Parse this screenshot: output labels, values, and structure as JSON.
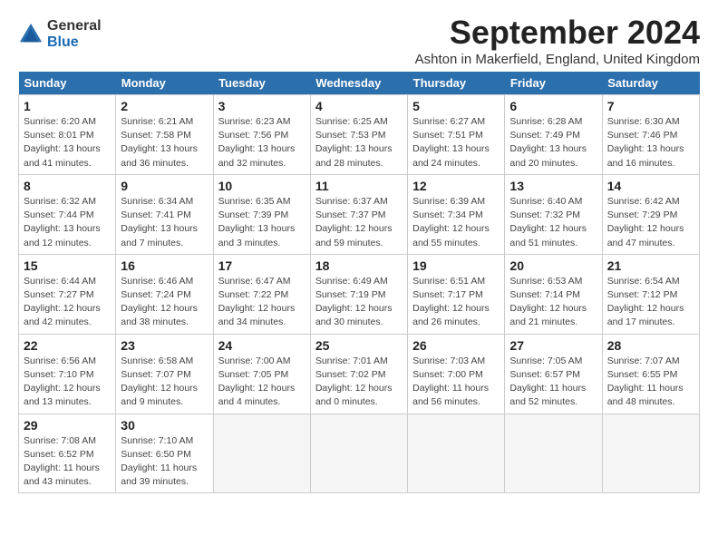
{
  "header": {
    "logo_general": "General",
    "logo_blue": "Blue",
    "month_title": "September 2024",
    "location": "Ashton in Makerfield, England, United Kingdom"
  },
  "weekdays": [
    "Sunday",
    "Monday",
    "Tuesday",
    "Wednesday",
    "Thursday",
    "Friday",
    "Saturday"
  ],
  "weeks": [
    [
      {
        "day": "1",
        "info": "Sunrise: 6:20 AM\nSunset: 8:01 PM\nDaylight: 13 hours\nand 41 minutes."
      },
      {
        "day": "2",
        "info": "Sunrise: 6:21 AM\nSunset: 7:58 PM\nDaylight: 13 hours\nand 36 minutes."
      },
      {
        "day": "3",
        "info": "Sunrise: 6:23 AM\nSunset: 7:56 PM\nDaylight: 13 hours\nand 32 minutes."
      },
      {
        "day": "4",
        "info": "Sunrise: 6:25 AM\nSunset: 7:53 PM\nDaylight: 13 hours\nand 28 minutes."
      },
      {
        "day": "5",
        "info": "Sunrise: 6:27 AM\nSunset: 7:51 PM\nDaylight: 13 hours\nand 24 minutes."
      },
      {
        "day": "6",
        "info": "Sunrise: 6:28 AM\nSunset: 7:49 PM\nDaylight: 13 hours\nand 20 minutes."
      },
      {
        "day": "7",
        "info": "Sunrise: 6:30 AM\nSunset: 7:46 PM\nDaylight: 13 hours\nand 16 minutes."
      }
    ],
    [
      {
        "day": "8",
        "info": "Sunrise: 6:32 AM\nSunset: 7:44 PM\nDaylight: 13 hours\nand 12 minutes."
      },
      {
        "day": "9",
        "info": "Sunrise: 6:34 AM\nSunset: 7:41 PM\nDaylight: 13 hours\nand 7 minutes."
      },
      {
        "day": "10",
        "info": "Sunrise: 6:35 AM\nSunset: 7:39 PM\nDaylight: 13 hours\nand 3 minutes."
      },
      {
        "day": "11",
        "info": "Sunrise: 6:37 AM\nSunset: 7:37 PM\nDaylight: 12 hours\nand 59 minutes."
      },
      {
        "day": "12",
        "info": "Sunrise: 6:39 AM\nSunset: 7:34 PM\nDaylight: 12 hours\nand 55 minutes."
      },
      {
        "day": "13",
        "info": "Sunrise: 6:40 AM\nSunset: 7:32 PM\nDaylight: 12 hours\nand 51 minutes."
      },
      {
        "day": "14",
        "info": "Sunrise: 6:42 AM\nSunset: 7:29 PM\nDaylight: 12 hours\nand 47 minutes."
      }
    ],
    [
      {
        "day": "15",
        "info": "Sunrise: 6:44 AM\nSunset: 7:27 PM\nDaylight: 12 hours\nand 42 minutes."
      },
      {
        "day": "16",
        "info": "Sunrise: 6:46 AM\nSunset: 7:24 PM\nDaylight: 12 hours\nand 38 minutes."
      },
      {
        "day": "17",
        "info": "Sunrise: 6:47 AM\nSunset: 7:22 PM\nDaylight: 12 hours\nand 34 minutes."
      },
      {
        "day": "18",
        "info": "Sunrise: 6:49 AM\nSunset: 7:19 PM\nDaylight: 12 hours\nand 30 minutes."
      },
      {
        "day": "19",
        "info": "Sunrise: 6:51 AM\nSunset: 7:17 PM\nDaylight: 12 hours\nand 26 minutes."
      },
      {
        "day": "20",
        "info": "Sunrise: 6:53 AM\nSunset: 7:14 PM\nDaylight: 12 hours\nand 21 minutes."
      },
      {
        "day": "21",
        "info": "Sunrise: 6:54 AM\nSunset: 7:12 PM\nDaylight: 12 hours\nand 17 minutes."
      }
    ],
    [
      {
        "day": "22",
        "info": "Sunrise: 6:56 AM\nSunset: 7:10 PM\nDaylight: 12 hours\nand 13 minutes."
      },
      {
        "day": "23",
        "info": "Sunrise: 6:58 AM\nSunset: 7:07 PM\nDaylight: 12 hours\nand 9 minutes."
      },
      {
        "day": "24",
        "info": "Sunrise: 7:00 AM\nSunset: 7:05 PM\nDaylight: 12 hours\nand 4 minutes."
      },
      {
        "day": "25",
        "info": "Sunrise: 7:01 AM\nSunset: 7:02 PM\nDaylight: 12 hours\nand 0 minutes."
      },
      {
        "day": "26",
        "info": "Sunrise: 7:03 AM\nSunset: 7:00 PM\nDaylight: 11 hours\nand 56 minutes."
      },
      {
        "day": "27",
        "info": "Sunrise: 7:05 AM\nSunset: 6:57 PM\nDaylight: 11 hours\nand 52 minutes."
      },
      {
        "day": "28",
        "info": "Sunrise: 7:07 AM\nSunset: 6:55 PM\nDaylight: 11 hours\nand 48 minutes."
      }
    ],
    [
      {
        "day": "29",
        "info": "Sunrise: 7:08 AM\nSunset: 6:52 PM\nDaylight: 11 hours\nand 43 minutes."
      },
      {
        "day": "30",
        "info": "Sunrise: 7:10 AM\nSunset: 6:50 PM\nDaylight: 11 hours\nand 39 minutes."
      },
      {
        "day": "",
        "info": ""
      },
      {
        "day": "",
        "info": ""
      },
      {
        "day": "",
        "info": ""
      },
      {
        "day": "",
        "info": ""
      },
      {
        "day": "",
        "info": ""
      }
    ]
  ]
}
